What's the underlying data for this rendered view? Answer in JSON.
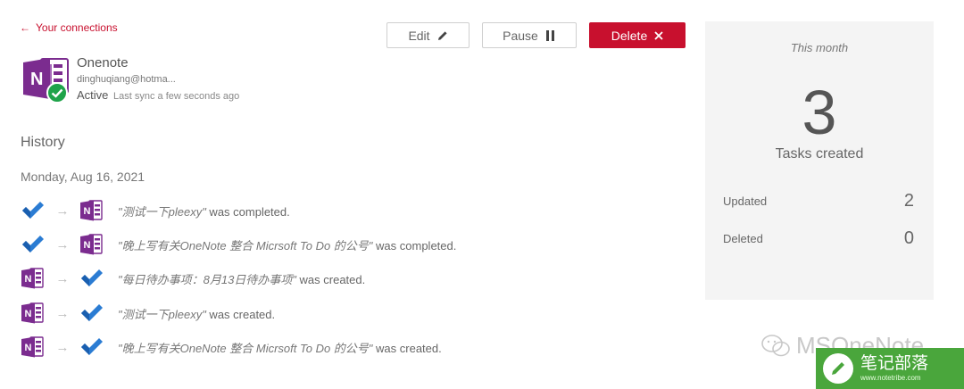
{
  "nav": {
    "back_label": "Your connections"
  },
  "actions": {
    "edit_label": "Edit",
    "pause_label": "Pause",
    "delete_label": "Delete"
  },
  "connection": {
    "name": "Onenote",
    "email": "dinghuqiang@hotma...",
    "status": "Active",
    "last_sync": "Last sync a few seconds ago"
  },
  "history": {
    "title": "History",
    "date": "Monday, Aug 16, 2021",
    "entries": [
      {
        "from_icon": "todo-check-icon",
        "to_icon": "onenote-icon",
        "quote": "\"测试一下pleexy\"",
        "suffix": " was completed."
      },
      {
        "from_icon": "todo-check-icon",
        "to_icon": "onenote-icon",
        "quote": "\"晚上写有关OneNote 整合 Micrsoft To Do 的公号\"",
        "suffix": " was completed."
      },
      {
        "from_icon": "onenote-icon",
        "to_icon": "todo-check-icon",
        "quote": "\"每日待办事项：8月13日待办事项\"",
        "suffix": " was created."
      },
      {
        "from_icon": "onenote-icon",
        "to_icon": "todo-check-icon",
        "quote": "\"测试一下pleexy\"",
        "suffix": " was created."
      },
      {
        "from_icon": "onenote-icon",
        "to_icon": "todo-check-icon",
        "quote": "\"晚上写有关OneNote 整合 Micrsoft To Do 的公号\"",
        "suffix": " was created."
      }
    ]
  },
  "stats": {
    "period": "This month",
    "tasks_created": "3",
    "tasks_created_label": "Tasks created",
    "updated_label": "Updated",
    "updated_value": "2",
    "deleted_label": "Deleted",
    "deleted_value": "0"
  },
  "watermark": {
    "text": "MSOneNote",
    "badge_title": "笔记部落",
    "badge_url": "www.notetribe.com"
  },
  "colors": {
    "accent": "#c8102e",
    "onenote_purple": "#7b2c8f",
    "todo_blue": "#2b7cd3",
    "active_green": "#1fa34a",
    "stats_bg": "#f4f4f4"
  }
}
